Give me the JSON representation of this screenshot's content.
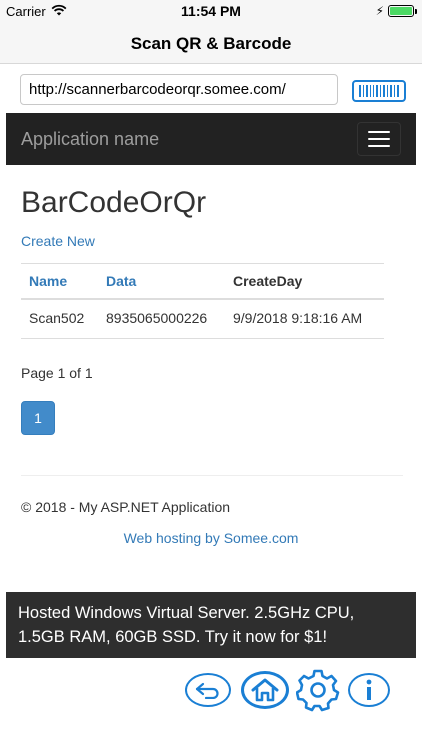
{
  "status_bar": {
    "carrier": "Carrier",
    "time": "11:54 PM",
    "icons": [
      "wifi-icon",
      "battery-icon",
      "charging-bolt-icon"
    ]
  },
  "nav": {
    "title": "Scan QR & Barcode"
  },
  "url_bar": {
    "value": "http://scannerbarcodeorqr.somee.com/",
    "scan_icon": "barcode-icon"
  },
  "web_navbar": {
    "brand": "Application name",
    "menu_icon": "hamburger-icon"
  },
  "page": {
    "title": "BarCodeOrQr",
    "create_link": "Create New",
    "table": {
      "headers": [
        "Name",
        "Data",
        "CreateDay"
      ],
      "rows": [
        [
          "Scan502",
          "8935065000226",
          "9/9/2018 9:18:16 AM"
        ]
      ]
    },
    "page_info": "Page 1 of 1",
    "pager": [
      "1"
    ],
    "footer_copyright": "© 2018 - My ASP.NET Application",
    "footer_link": "Web hosting by Somee.com"
  },
  "ad": {
    "line1": "Hosted Windows Virtual Server. 2.5GHz CPU,",
    "line2": "1.5GB RAM, 60GB SSD. Try it now for $1!"
  },
  "toolbar": {
    "buttons": [
      "back-icon",
      "home-icon",
      "settings-gear-icon",
      "info-icon"
    ]
  },
  "colors": {
    "accent": "#1a7fd4",
    "link": "#337ab7",
    "navbar_bg": "#222222",
    "pager_active": "#428bca",
    "ad_bg": "#2e2e2e"
  }
}
